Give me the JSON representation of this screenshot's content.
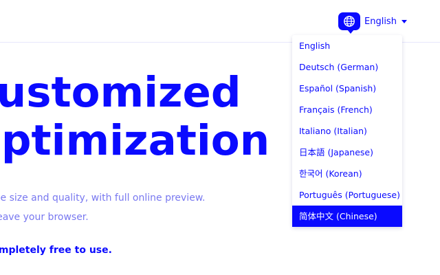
{
  "header": {
    "language_button": {
      "icon": "globe-icon",
      "label": "English"
    }
  },
  "hero": {
    "title_line_1": "Customized",
    "title_line_2": "Optimization",
    "subtitle_line_1": "Choose the size and quality, with full online preview.",
    "subtitle_line_2": "Never leave your browser.",
    "free_text": "Completely free to use."
  },
  "language_menu": {
    "items": [
      {
        "label": "English"
      },
      {
        "label": "Deutsch (German)"
      },
      {
        "label": "Español (Spanish)"
      },
      {
        "label": "Français (French)"
      },
      {
        "label": "Italiano (Italian)"
      },
      {
        "label": "日本語 (Japanese)"
      },
      {
        "label": "한국어 (Korean)"
      },
      {
        "label": "Português (Portuguese)"
      },
      {
        "label": "简体中文 (Chinese)"
      }
    ],
    "highlighted": "简体中文 (Chinese)"
  },
  "colors": {
    "accent": "#0a0aff",
    "muted_text": "#7878f0",
    "background": "#ffffff"
  }
}
